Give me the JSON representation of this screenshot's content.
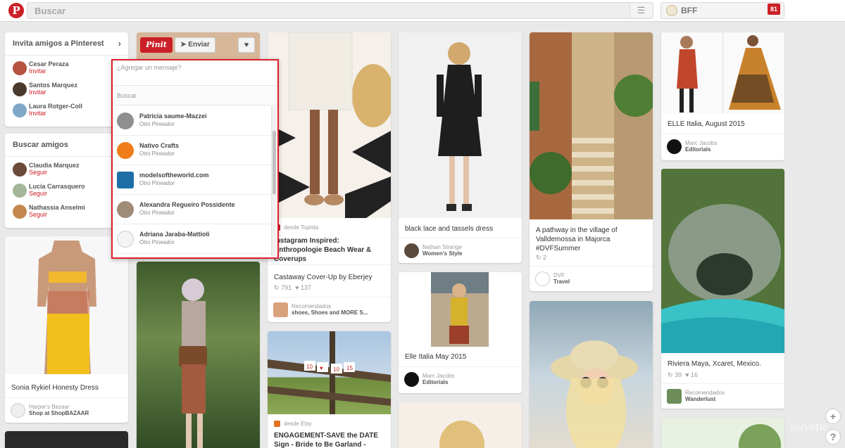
{
  "header": {
    "search_placeholder": "Buscar",
    "user_name": "BFF",
    "notification_count": "81"
  },
  "sidebar": {
    "invite": {
      "title": "Invita amigos a Pinterest",
      "friends": [
        {
          "name": "Cesar Peraza",
          "action": "Invitar"
        },
        {
          "name": "Santos Marquez",
          "action": "Invitar"
        },
        {
          "name": "Laura Rotger-Coll",
          "action": "Invitar"
        }
      ]
    },
    "find": {
      "title": "Buscar amigos",
      "friends": [
        {
          "name": "Claudia Marquez",
          "action": "Seguir"
        },
        {
          "name": "Lucia Carrasquero",
          "action": "Seguir"
        },
        {
          "name": "Nathassia Anselmi",
          "action": "Seguir"
        }
      ]
    }
  },
  "pin_actions": {
    "pinit": "Pinit",
    "send": "Enviar"
  },
  "send_popup": {
    "message_placeholder": "¿Agregar un mensaje?",
    "search_placeholder": "Buscar",
    "contacts": [
      {
        "name": "Patricia saume-Mazzei",
        "role": "Otro Pineador"
      },
      {
        "name": "Nativo Crafts",
        "role": "Otro Pineador"
      },
      {
        "name": "modelsoftheworld.com",
        "role": "Otro Pineador"
      },
      {
        "name": "Alexandra Regueiro Possidente",
        "role": "Otro Pineador"
      },
      {
        "name": "Adriana Jaraba-Mattioli",
        "role": "Otro Pineador"
      }
    ]
  },
  "pins": {
    "sonia": {
      "desc": "Sonia Rykiel Honesty Dress",
      "user": "Harper's Bazaar",
      "board": "Shop at ShopBAZAAR"
    },
    "instagram": {
      "source": "desde Topista",
      "title": "Instagram Inspired: Anthropologie Beach Wear & Coverups",
      "desc": "Castaway Cover-Up by Eberjey",
      "repins": "791",
      "likes": "137",
      "user": "Recomendados",
      "board": "shoes, Shoes and MORE S..."
    },
    "engagement": {
      "source": "desde Etsy",
      "title": "ENGAGEMENT-SAVE the DATE Sign - Bride to Be Garland -"
    },
    "black_lace": {
      "desc": "black lace and tassels dress",
      "user": "Nathan Strange",
      "board": "Women's Style"
    },
    "elle_may": {
      "desc": "Elle Italia May 2015",
      "user": "Marc Jacobs",
      "board": "Editorials"
    },
    "mallorca": {
      "desc": "A pathway in the village of Valldemossa in Majorca #DVFSummer",
      "repins": "2",
      "user": "DVF",
      "board": "Travel"
    },
    "elle_aug": {
      "desc": "ELLE Italia, August 2015",
      "user": "Marc Jacobs",
      "board": "Editorials"
    },
    "riviera": {
      "desc": "Riviera Maya, Xcaret, Mexico.",
      "repins": "39",
      "likes": "16",
      "user": "Recomendados",
      "board": "Wanderlust"
    }
  },
  "watermark": "solvetic",
  "colors": {
    "brand_red": "#cb2027",
    "popup_border": "#d9202a",
    "background": "#e9e9e9"
  }
}
